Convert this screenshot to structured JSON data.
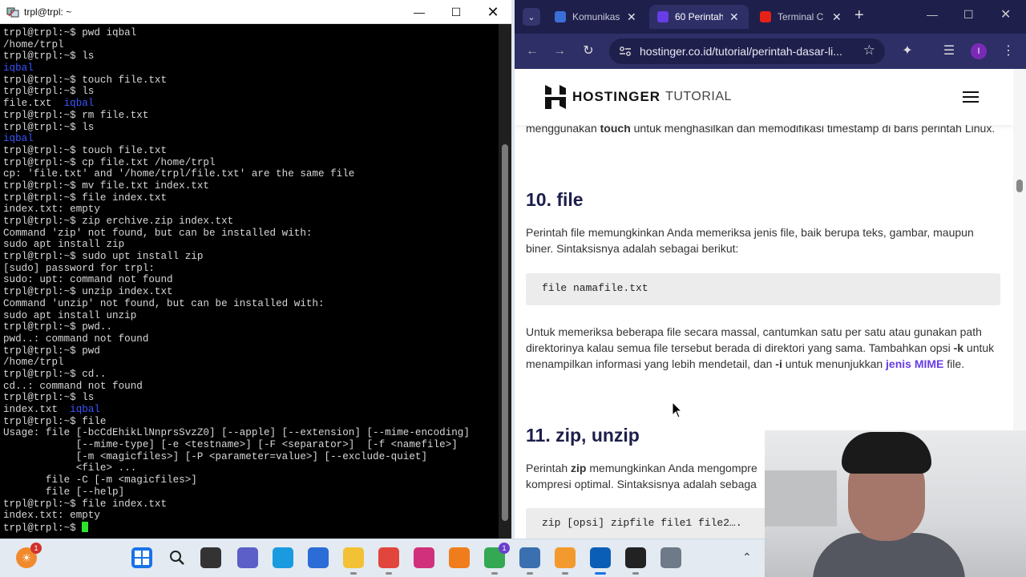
{
  "terminal": {
    "title": "trpl@trpl: ~",
    "lines": [
      {
        "text": "trpl@trpl:~$ pwd iqbal"
      },
      {
        "text": "/home/trpl"
      },
      {
        "text": "trpl@trpl:~$ ls"
      },
      {
        "text": "iqbal",
        "color": "blue"
      },
      {
        "text": "trpl@trpl:~$ touch file.txt"
      },
      {
        "text": "trpl@trpl:~$ ls"
      },
      {
        "text": "file.txt  ",
        "extra": "iqbal"
      },
      {
        "text": "trpl@trpl:~$ rm file.txt"
      },
      {
        "text": "trpl@trpl:~$ ls"
      },
      {
        "text": "iqbal",
        "color": "blue"
      },
      {
        "text": "trpl@trpl:~$ touch file.txt"
      },
      {
        "text": "trpl@trpl:~$ cp file.txt /home/trpl"
      },
      {
        "text": "cp: 'file.txt' and '/home/trpl/file.txt' are the same file"
      },
      {
        "text": "trpl@trpl:~$ mv file.txt index.txt"
      },
      {
        "text": "trpl@trpl:~$ file index.txt"
      },
      {
        "text": "index.txt: empty"
      },
      {
        "text": "trpl@trpl:~$ zip erchive.zip index.txt"
      },
      {
        "text": "Command 'zip' not found, but can be installed with:"
      },
      {
        "text": "sudo apt install zip"
      },
      {
        "text": "trpl@trpl:~$ sudo upt install zip"
      },
      {
        "text": "[sudo] password for trpl:"
      },
      {
        "text": "sudo: upt: command not found"
      },
      {
        "text": "trpl@trpl:~$ unzip index.txt"
      },
      {
        "text": "Command 'unzip' not found, but can be installed with:"
      },
      {
        "text": "sudo apt install unzip"
      },
      {
        "text": "trpl@trpl:~$ pwd.."
      },
      {
        "text": "pwd..: command not found"
      },
      {
        "text": "trpl@trpl:~$ pwd"
      },
      {
        "text": "/home/trpl"
      },
      {
        "text": "trpl@trpl:~$ cd.."
      },
      {
        "text": "cd..: command not found"
      },
      {
        "text": "trpl@trpl:~$ ls"
      },
      {
        "text": "index.txt  ",
        "extra": "iqbal"
      },
      {
        "text": "trpl@trpl:~$ file"
      },
      {
        "text": "Usage: file [-bcCdEhikLlNnprsSvzZ0] [--apple] [--extension] [--mime-encoding]"
      },
      {
        "text": "            [--mime-type] [-e <testname>] [-F <separator>]  [-f <namefile>]"
      },
      {
        "text": "            [-m <magicfiles>] [-P <parameter=value>] [--exclude-quiet]"
      },
      {
        "text": "            <file> ..."
      },
      {
        "text": "       file -C [-m <magicfiles>]"
      },
      {
        "text": "       file [--help]"
      },
      {
        "text": "trpl@trpl:~$ file index.txt"
      },
      {
        "text": "index.txt: empty"
      },
      {
        "text": "trpl@trpl:~$ ",
        "cursor": true
      }
    ]
  },
  "browser": {
    "tabs": [
      {
        "title": "Komunikasi",
        "color": "#3b6fd8"
      },
      {
        "title": "60 Perintah",
        "color": "#673de6",
        "active": true
      },
      {
        "title": "Terminal C",
        "color": "#e62117"
      }
    ],
    "url": "hostinger.co.id/tutorial/perintah-dasar-li...",
    "profile_initial": "I",
    "site": {
      "brand": "HOSTINGER",
      "section": "TUTORIAL"
    },
    "intro_pre": "menggunakan ",
    "intro_bold": "touch",
    "intro_post": " untuk menghasilkan dan memodifikasi timestamp di baris perintah Linux.",
    "h_file": "10. file",
    "p_file": "Perintah file memungkinkan Anda memeriksa jenis file, baik berupa teks, gambar, maupun biner. Sintaksisnya adalah sebagai berikut:",
    "code_file": "file namafile.txt",
    "p2_a": "Untuk memeriksa beberapa file secara massal, cantumkan satu per satu atau gunakan path direktorinya kalau semua file tersebut berada di direktori yang sama. Tambahkan opsi ",
    "p2_k": "-k",
    "p2_b": " untuk menampilkan informasi yang lebih mendetail, dan ",
    "p2_i": "-i",
    "p2_c": " untuk menunjukkan ",
    "p2_link": "jenis MIME",
    "p2_d": " file.",
    "h_zip": "11. zip, unzip",
    "p_zip_a": "Perintah ",
    "p_zip_b": "zip",
    "p_zip_c": " memungkinkan Anda mengompre",
    "p_zip_d": "kompresi optimal. Sintaksisnya adalah sebaga",
    "code_zip": "zip [opsi] zipfile file1 file2…."
  },
  "taskbar": {
    "weather_badge": "1",
    "chrome_badge": "1",
    "apps": [
      {
        "name": "start-button",
        "color": "#1a73e8"
      },
      {
        "name": "search-button",
        "color": "#e3eaf2"
      },
      {
        "name": "task-view-button",
        "color": "#333333"
      },
      {
        "name": "teams-button",
        "color": "#5b5fc7"
      },
      {
        "name": "edge-button",
        "color": "#1a9be0"
      },
      {
        "name": "store-button",
        "color": "#2b6cd6"
      },
      {
        "name": "file-explorer-button",
        "color": "#f3c135"
      },
      {
        "name": "chrome-button",
        "color": "#e2453c"
      },
      {
        "name": "instagram-button",
        "color": "#d0307c"
      },
      {
        "name": "xampp-button",
        "color": "#f07d1c"
      },
      {
        "name": "chrome-profile-button",
        "color": "#34a853"
      },
      {
        "name": "virtualbox-button",
        "color": "#3a6fb0"
      },
      {
        "name": "sublime-button",
        "color": "#f39a2e"
      },
      {
        "name": "terminal-app-button",
        "color": "#0a5eb5"
      },
      {
        "name": "obs-button",
        "color": "#222222"
      },
      {
        "name": "settings-button",
        "color": "#6e7a88"
      }
    ]
  }
}
